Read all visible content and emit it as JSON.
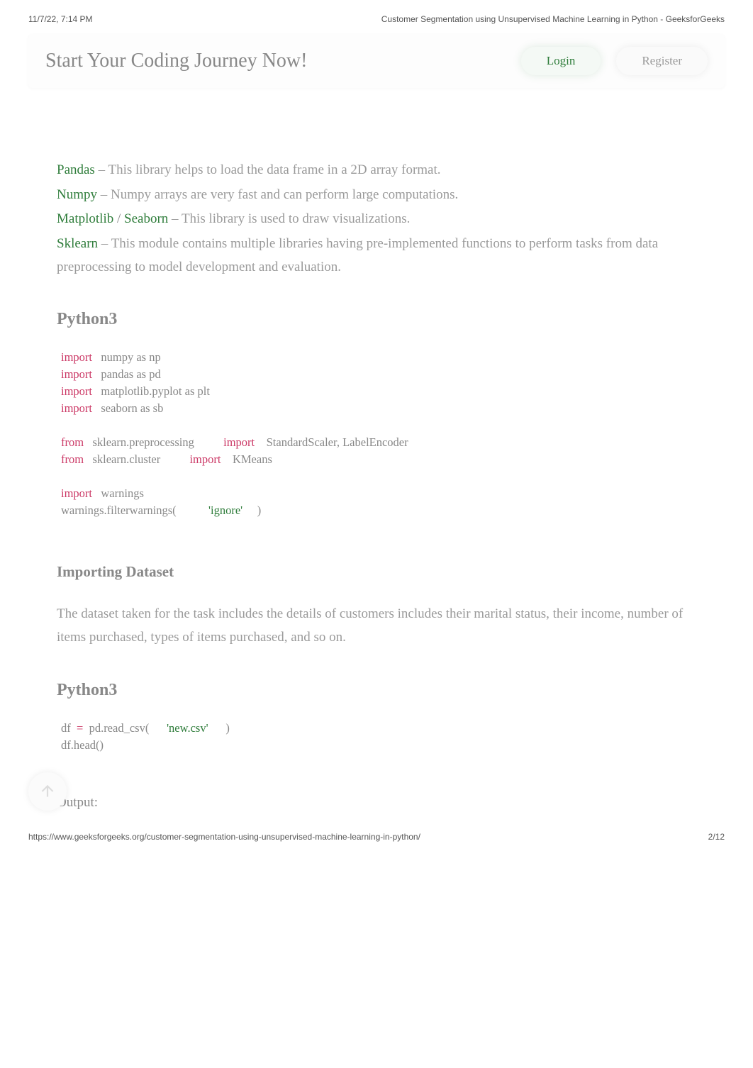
{
  "header": {
    "timestamp": "11/7/22, 7:14 PM",
    "title": "Customer Segmentation using Unsupervised Machine Learning in Python - GeeksforGeeks"
  },
  "banner": {
    "title": "Start Your Coding Journey Now!",
    "login_label": "Login",
    "register_label": "Register"
  },
  "libs": [
    {
      "links": [
        {
          "label": "Pandas"
        }
      ],
      "desc": " – This library helps to load the data frame in a 2D array format."
    },
    {
      "links": [
        {
          "label": "Numpy"
        }
      ],
      "desc": " – Numpy arrays are very fast and can perform large computations."
    },
    {
      "links": [
        {
          "label": "Matplotlib"
        },
        {
          "label": "Seaborn"
        }
      ],
      "sep": " / ",
      "desc": " – This library is used to draw visualizations."
    },
    {
      "links": [
        {
          "label": "Sklearn"
        }
      ],
      "desc": " – This module contains multiple libraries having pre-implemented functions to perform tasks from data preprocessing to model development and evaluation."
    }
  ],
  "lang_label_1": "Python3",
  "code1": {
    "l1": {
      "kw": "import",
      "rest": "   numpy as np"
    },
    "l2": {
      "kw": "import",
      "rest": "   pandas as pd"
    },
    "l3": {
      "kw": "import",
      "rest": "   matplotlib.pyplot as plt"
    },
    "l4": {
      "kw": "import",
      "rest": "   seaborn as sb"
    },
    "l5a": {
      "kw": "from",
      "mid": "   sklearn.preprocessing          ",
      "kw2": "import",
      "rest": "    StandardScaler, LabelEncoder"
    },
    "l5b": {
      "kw": "from",
      "mid": "   sklearn.cluster          ",
      "kw2": "import",
      "rest": "    KMeans"
    },
    "l6": {
      "kw": "import",
      "rest": "   warnings"
    },
    "l7a": "warnings.filterwarnings(           ",
    "l7s": "'ignore'",
    "l7b": "     )"
  },
  "sub1": "Importing Dataset",
  "para1": "The dataset taken for the task includes the details of customers includes their marital status, their income, number of items purchased, types of items purchased, and so on.",
  "lang_label_2": "Python3",
  "code2": {
    "l1a": "df  ",
    "l1op": "=",
    "l1b": "  pd.read_csv(      ",
    "l1s": "'new.csv'",
    "l1c": "      )",
    "l2": "df.head()"
  },
  "output_label": "Output:",
  "footer": {
    "url": "https://www.geeksforgeeks.org/customer-segmentation-using-unsupervised-machine-learning-in-python/",
    "page": "2/12"
  },
  "fab_name": "scroll-up-icon"
}
